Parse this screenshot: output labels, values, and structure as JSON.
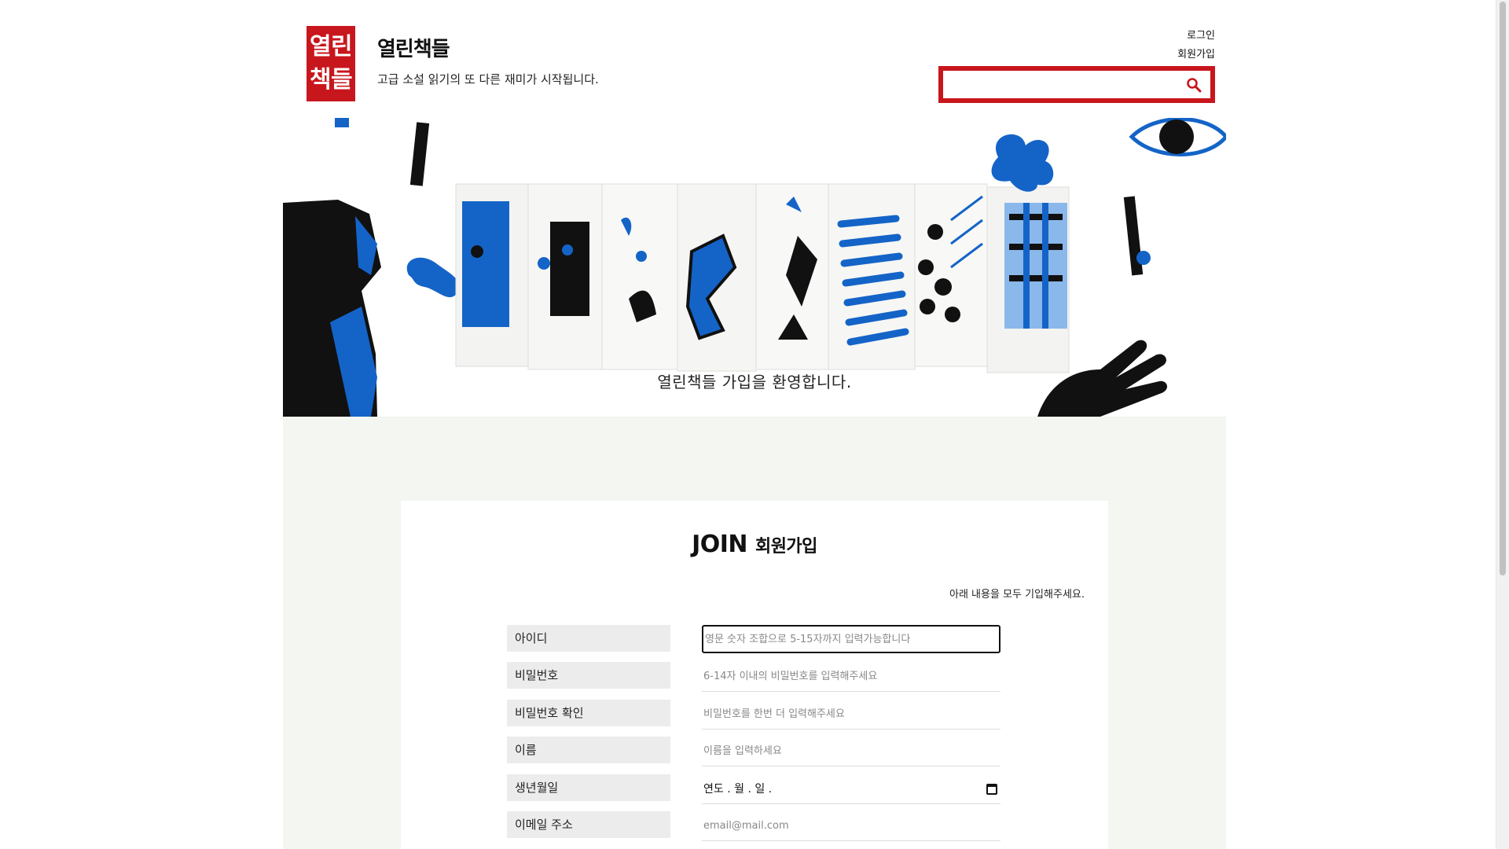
{
  "header": {
    "logo_chars": [
      "열",
      "린",
      "책",
      "들"
    ],
    "site_title": "열린책들",
    "tagline": "고급 소설 읽기의 또 다른 재미가 시작됩니다.",
    "login_label": "로그인",
    "signup_label": "회원가입",
    "search": {
      "placeholder": "",
      "value": ""
    }
  },
  "hero": {
    "welcome_text": "열린책들 가입을 환영합니다."
  },
  "form": {
    "title": "JOIN",
    "title_ko": "회원가입",
    "note": "아래 내용을 모두 기입해주세요.",
    "fields": [
      {
        "label": "아이디",
        "placeholder": "영문 숫자 조합으로 5-15자까지 입력가능합니다"
      },
      {
        "label": "비밀번호",
        "placeholder": "6-14자 이내의 비밀번호를 입력해주세요"
      },
      {
        "label": "비밀번호 확인",
        "placeholder": "비밀번호를 한번 더 입력해주세요"
      },
      {
        "label": "이름",
        "placeholder": "이름을 입력하세요"
      },
      {
        "label": "생년월일",
        "value": "연도 . 월 . 일 ."
      },
      {
        "label": "이메일 주소",
        "placeholder": "email@mail.com"
      }
    ]
  },
  "colors": {
    "brand_red": "#c8161d",
    "illustration_blue": "#1464c8",
    "panel_bg": "#f3f6f1"
  }
}
